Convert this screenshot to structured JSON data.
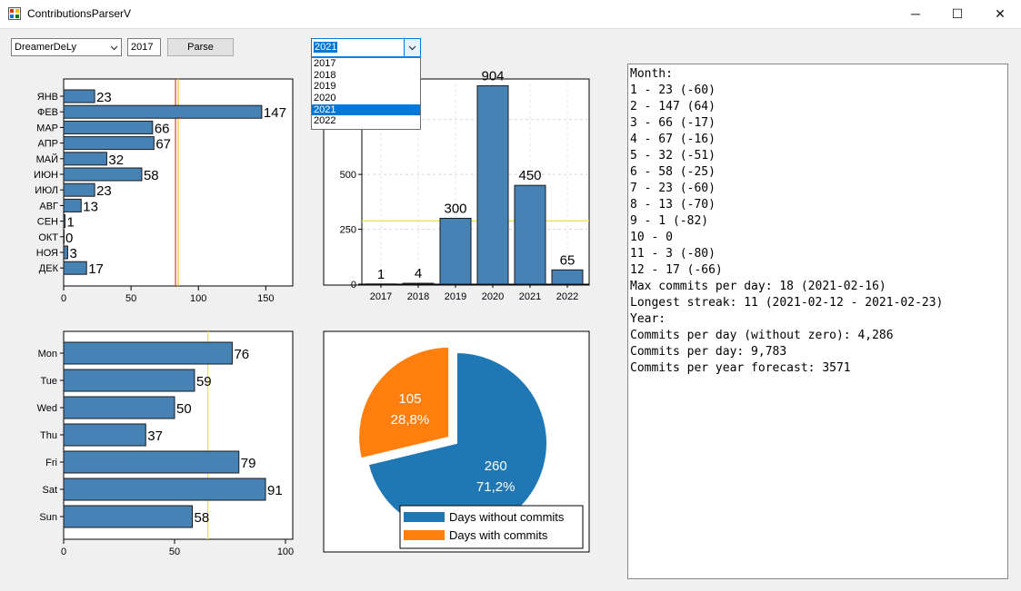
{
  "window": {
    "title": "ContributionsParserV",
    "minimize_glyph": "─",
    "maximize_glyph": "☐",
    "close_glyph": "✕"
  },
  "toolbar": {
    "user_value": "DreamerDeLy",
    "year_value": "2017",
    "parse_label": "Parse",
    "year_select_value": "2021"
  },
  "year_dropdown": {
    "options": [
      "2017",
      "2018",
      "2019",
      "2020",
      "2021",
      "2022"
    ],
    "selected_index": 4
  },
  "colors": {
    "bar": "#4682b4",
    "pie_blue": "#1f77b4",
    "pie_orange": "#ff7f0e",
    "avg_line_red": "#e03a1e",
    "avg_line_yellow": "#f0e040"
  },
  "chart_data": [
    {
      "type": "bar",
      "orientation": "horizontal",
      "categories": [
        "ЯНВ",
        "ФЕВ",
        "МАР",
        "АПР",
        "МАЙ",
        "ИЮН",
        "ИЮЛ",
        "АВГ",
        "СЕН",
        "ОКТ",
        "НОЯ",
        "ДЕК"
      ],
      "values": [
        23,
        147,
        66,
        67,
        32,
        58,
        23,
        13,
        1,
        0,
        3,
        17
      ],
      "xlim": [
        0,
        170
      ],
      "xticks": [
        0,
        50,
        100,
        150
      ],
      "reference_lines": [
        83,
        85
      ]
    },
    {
      "type": "bar",
      "orientation": "vertical",
      "categories": [
        "2017",
        "2018",
        "2019",
        "2020",
        "2021",
        "2022"
      ],
      "values": [
        1,
        4,
        300,
        904,
        450,
        65
      ],
      "ylim": [
        0,
        1000
      ],
      "yticks": [
        0,
        250,
        500,
        750
      ],
      "reference_line": 288,
      "grid": true
    },
    {
      "type": "bar",
      "orientation": "horizontal",
      "categories": [
        "Mon",
        "Tue",
        "Wed",
        "Thu",
        "Fri",
        "Sat",
        "Sun"
      ],
      "values": [
        76,
        59,
        50,
        37,
        79,
        91,
        58
      ],
      "xlim": [
        0,
        100
      ],
      "xticks": [
        0,
        50,
        100
      ],
      "reference_line": 65
    },
    {
      "type": "pie",
      "slices": [
        {
          "name": "Days without commits",
          "value": 260,
          "percent_label": "71,2%"
        },
        {
          "name": "Days with commits",
          "value": 105,
          "percent_label": "28,8%"
        }
      ],
      "legend": "bottom-right"
    }
  ],
  "output_lines": [
    "Month:",
    "1 - 23 (-60)",
    "2 - 147 (64)",
    "3 - 66 (-17)",
    "4 - 67 (-16)",
    "5 - 32 (-51)",
    "6 - 58 (-25)",
    "7 - 23 (-60)",
    "8 - 13 (-70)",
    "9 - 1 (-82)",
    "10 - 0",
    "11 - 3 (-80)",
    "12 - 17 (-66)",
    "Max commits per day: 18 (2021-02-16)",
    "Longest streak: 11 (2021-02-12 - 2021-02-23)",
    "Year:",
    "Commits per day (without zero): 4,286",
    "Commits per day: 9,783",
    "Commits per year forecast: 3571"
  ]
}
